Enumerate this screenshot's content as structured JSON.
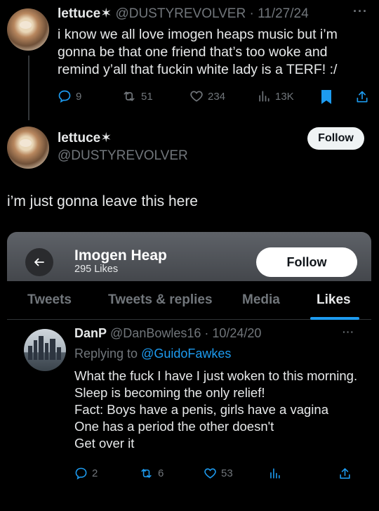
{
  "tweet1": {
    "display_name": "lettuce✶",
    "handle_date": "@DUSTYREVOLVER · 11/27/24",
    "text": "i know we all love imogen heaps music but i’m gonna be that one friend that’s too woke and remind y’all that fuckin white lady is a TERF! :/",
    "more_icon": "more-dots-icon",
    "replies": "9",
    "retweets": "51",
    "likes": "234",
    "views": "13K"
  },
  "tweet2": {
    "display_name": "lettuce✶",
    "handle": "@DUSTYREVOLVER",
    "follow_label": "Follow",
    "text": "i’m just gonna leave this here"
  },
  "screenshot_card": {
    "title": "Imogen Heap",
    "subtitle": "295 Likes",
    "follow_label": "Follow",
    "tabs": [
      "Tweets",
      "Tweets & replies",
      "Media",
      "Likes"
    ],
    "active_tab": "Likes",
    "accent_color": "#1d9bf0",
    "post": {
      "display_name": "DanP",
      "handle_date": "@DanBowles16 · 10/24/20",
      "replying_prefix": "Replying to ",
      "replying_to": "@GuidoFawkes",
      "text": "What the fuck I have I just woken to this morning. Sleep is becoming the only relief!\nFact: Boys have a penis, girls have a vagina\nOne has a period the other doesn't\nGet over it",
      "replies": "2",
      "retweets": "6",
      "likes": "53"
    }
  }
}
